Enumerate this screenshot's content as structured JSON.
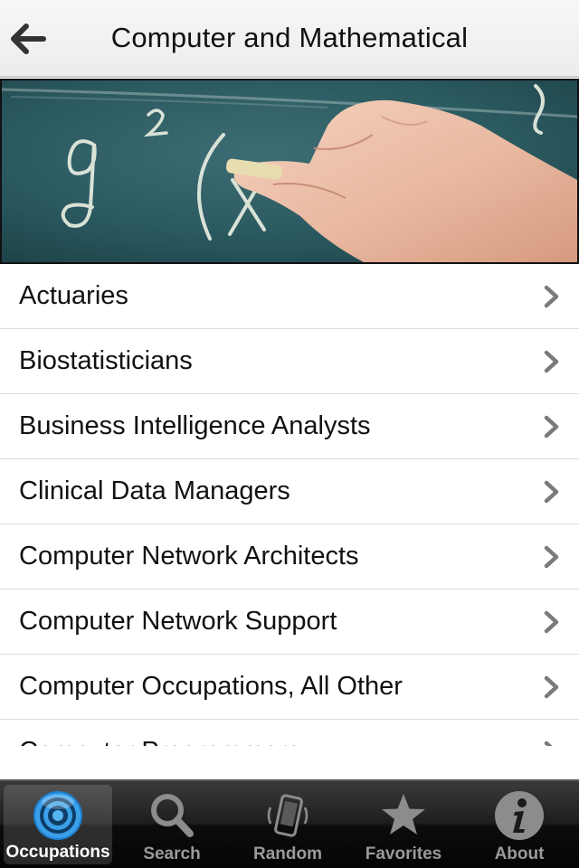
{
  "header": {
    "title": "Computer and Mathematical",
    "back_icon": "back-arrow-icon"
  },
  "hero": {
    "image": "hand-writing-on-chalkboard"
  },
  "list": {
    "items": [
      {
        "label": "Actuaries"
      },
      {
        "label": "Biostatisticians"
      },
      {
        "label": "Business Intelligence Analysts"
      },
      {
        "label": "Clinical Data Managers"
      },
      {
        "label": "Computer Network Architects"
      },
      {
        "label": "Computer Network Support"
      },
      {
        "label": "Computer Occupations, All Other"
      },
      {
        "label": "Computer Programmers"
      }
    ]
  },
  "tabbar": {
    "tabs": [
      {
        "label": "Occupations",
        "icon": "target-icon",
        "active": true
      },
      {
        "label": "Search",
        "icon": "search-icon",
        "active": false
      },
      {
        "label": "Random",
        "icon": "shake-phone-icon",
        "active": false
      },
      {
        "label": "Favorites",
        "icon": "star-icon",
        "active": false
      },
      {
        "label": "About",
        "icon": "info-icon",
        "active": false
      }
    ]
  },
  "colors": {
    "active_tab_accent": "#3aa0e8",
    "chalkboard": "#2c5a62"
  }
}
